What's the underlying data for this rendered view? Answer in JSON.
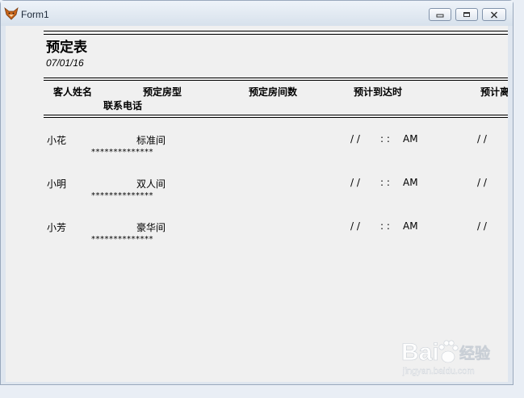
{
  "window": {
    "title": "Form1",
    "icon": "fox-icon",
    "controls": [
      "minimize-icon",
      "restore-icon",
      "close-icon"
    ]
  },
  "report": {
    "title": "预定表",
    "date": "07/01/16",
    "headers": {
      "guest_name": "客人姓名",
      "room_type": "预定房型",
      "room_count": "预定房间数",
      "arrival": "预计到达时",
      "departure": "预计离",
      "phone": "联系电话"
    },
    "rows": [
      {
        "name": "小花",
        "room_type": "标准间",
        "arrival_date": "/ /",
        "arrival_time": ": :",
        "ampm": "AM",
        "departure_date": "/ /",
        "phone": "**************"
      },
      {
        "name": "小明",
        "room_type": "双人间",
        "arrival_date": "/ /",
        "arrival_time": ": :",
        "ampm": "AM",
        "departure_date": "/ /",
        "phone": "**************"
      },
      {
        "name": "小芳",
        "room_type": "豪华间",
        "arrival_date": "/ /",
        "arrival_time": ": :",
        "ampm": "AM",
        "departure_date": "/ /",
        "phone": "**************"
      }
    ]
  },
  "watermark": {
    "brand_left": "Bai",
    "brand_right": "经验",
    "url": "jingyan.baidu.com"
  }
}
